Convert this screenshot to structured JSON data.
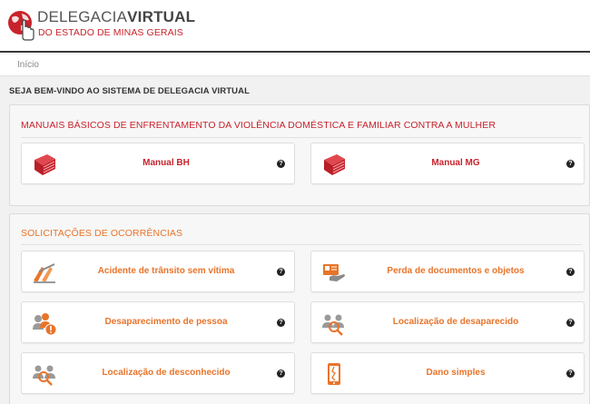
{
  "header": {
    "logo_line1_light": "DELEGACIA",
    "logo_line1_bold": "VIRTUAL",
    "logo_line2": "DO ESTADO DE MINAS GERAIS"
  },
  "breadcrumb": {
    "home": "Início"
  },
  "welcome": "SEJA BEM-VINDO AO SISTEMA DE DELEGACIA VIRTUAL",
  "manuals": {
    "title": "MANUAIS BÁSICOS DE ENFRENTAMENTO DA VIOLÊNCIA DOMÉSTICA E FAMILIAR CONTRA A MULHER",
    "items": [
      {
        "label": "Manual BH",
        "icon": "book-icon"
      },
      {
        "label": "Manual MG",
        "icon": "book-icon"
      }
    ]
  },
  "requests": {
    "title": "SOLICITAÇÕES DE OCORRÊNCIAS",
    "items": [
      {
        "label": "Acidente de trânsito sem vítima",
        "icon": "traffic-accident-icon"
      },
      {
        "label": "Perda de documentos e objetos",
        "icon": "lost-documents-icon"
      },
      {
        "label": "Desaparecimento de pessoa",
        "icon": "missing-person-icon"
      },
      {
        "label": "Localização de desaparecido",
        "icon": "locate-missing-icon"
      },
      {
        "label": "Localização de desconhecido",
        "icon": "locate-unknown-icon"
      },
      {
        "label": "Dano simples",
        "icon": "damage-phone-icon"
      }
    ]
  },
  "help_glyph": "?",
  "colors": {
    "red": "#c8232c",
    "orange": "#e8742a",
    "dark": "#3a3a3a"
  }
}
